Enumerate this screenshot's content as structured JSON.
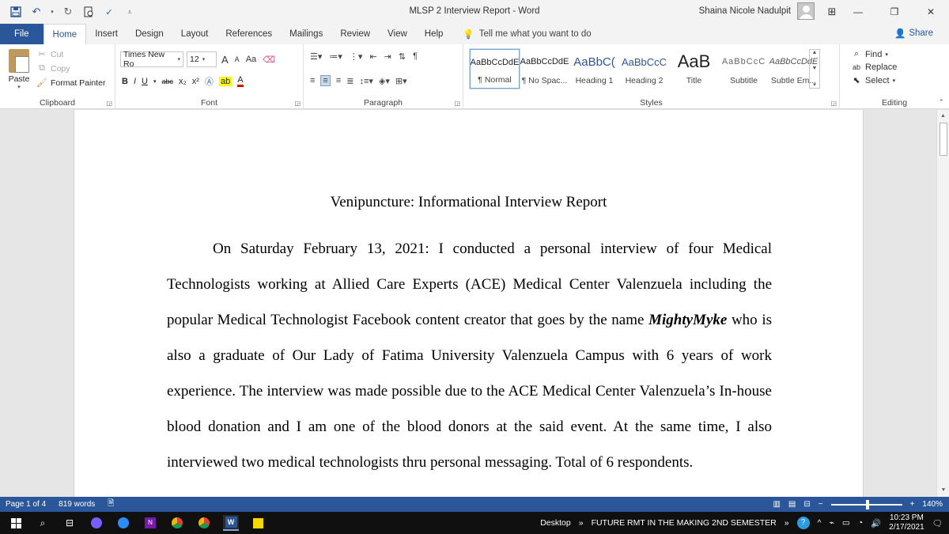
{
  "window": {
    "title": "MLSP 2 Interview Report  -  Word",
    "user": "Shaina Nicole Nadulpit"
  },
  "qat": {
    "save_icon": "save-icon",
    "undo_icon": "undo-icon",
    "redo_icon": "redo-icon",
    "print_preview_icon": "print-preview-icon",
    "spelling_icon": "spelling-icon"
  },
  "tabs": [
    "File",
    "Home",
    "Insert",
    "Design",
    "Layout",
    "References",
    "Mailings",
    "Review",
    "View",
    "Help"
  ],
  "tell_me": "Tell me what you want to do",
  "share": "Share",
  "clipboard": {
    "paste": "Paste",
    "cut": "Cut",
    "copy": "Copy",
    "format_painter": "Format Painter",
    "label": "Clipboard"
  },
  "font": {
    "name": "Times New Ro",
    "size": "12",
    "grow": "A",
    "shrink": "A",
    "change_case": "Aa",
    "bold": "B",
    "italic": "I",
    "underline": "U",
    "strike": "abc",
    "subscript": "x₂",
    "superscript": "x²",
    "label": "Font",
    "highlight_color": "#ffff00",
    "font_color": "#e00000"
  },
  "paragraph": {
    "label": "Paragraph"
  },
  "styles": {
    "label": "Styles",
    "items": [
      {
        "preview": "AaBbCcDdE",
        "name": "¶ Normal"
      },
      {
        "preview": "AaBbCcDdE",
        "name": "¶ No Spac..."
      },
      {
        "preview": "AaBbC(",
        "name": "Heading 1"
      },
      {
        "preview": "AaBbCcC",
        "name": "Heading 2"
      },
      {
        "preview": "AaB",
        "name": "Title"
      },
      {
        "preview": "AaBbCcC",
        "name": "Subtitle"
      },
      {
        "preview": "AaBbCcDdE",
        "name": "Subtle Em..."
      }
    ]
  },
  "editing": {
    "find": "Find",
    "replace": "Replace",
    "select": "Select",
    "label": "Editing"
  },
  "document": {
    "heading": "Venipuncture: Informational Interview Report",
    "para_before": "On Saturday February 13, 2021: I conducted a personal interview of four Medical Technologists working at Allied Care Experts (ACE) Medical Center Valenzuela including the popular Medical Technologist Facebook content creator that goes by the name ",
    "para_emph": "MightyMyke",
    "para_after": " who is also a graduate of Our Lady of Fatima University Valenzuela Campus with 6 years of work experience. The interview was made possible due to the ACE Medical Center Valenzuela’s In-house blood donation and I am one of the blood donors at the said event. At the same time, I also interviewed two medical technologists thru personal messaging. Total of 6 respondents."
  },
  "status": {
    "page": "Page 1 of 4",
    "words": "819 words",
    "zoom": "140%",
    "zoom_minus": "−",
    "zoom_plus": "+",
    "zoom_level_percent": 140
  },
  "taskbar": {
    "desktop": "Desktop",
    "folder": "FUTURE RMT IN THE MAKING 2ND SEMESTER",
    "time": "10:23 PM",
    "date": "2/17/2021",
    "chevron": "»"
  },
  "colors": {
    "accent": "#2b579a",
    "taskbar": "#101010"
  }
}
